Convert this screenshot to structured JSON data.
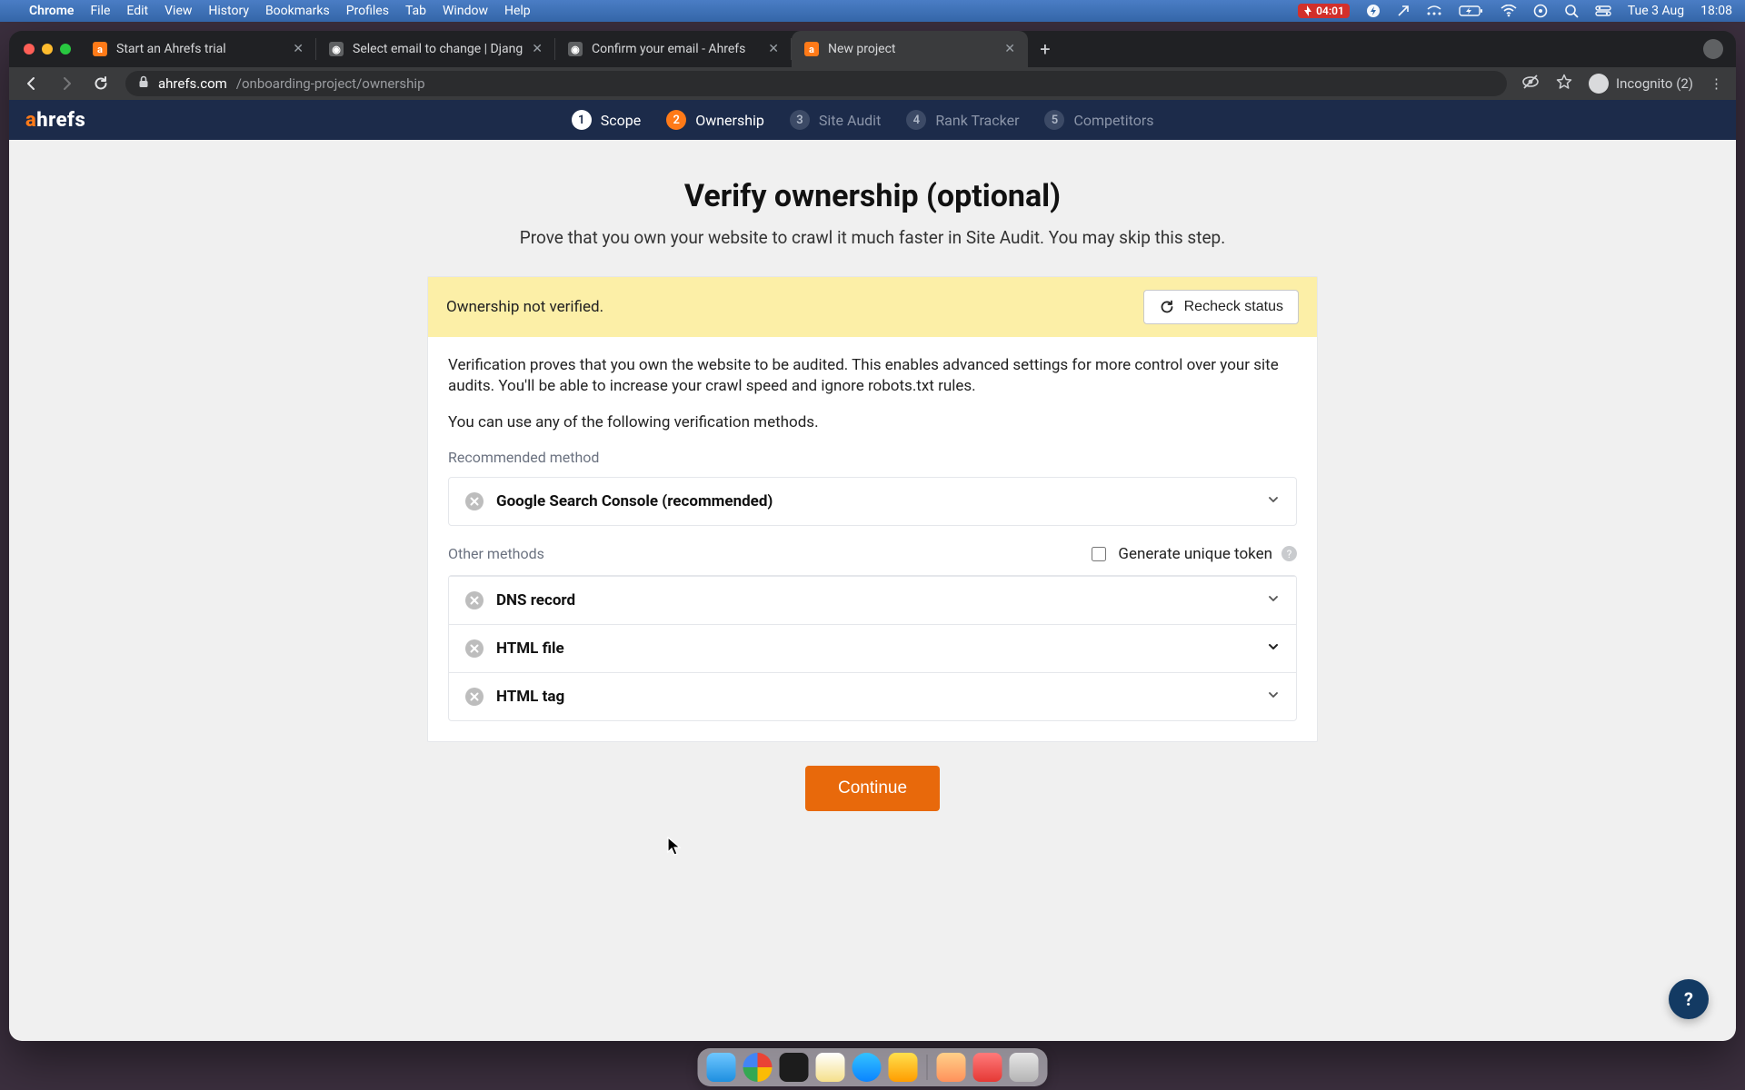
{
  "menubar": {
    "app": "Chrome",
    "items": [
      "File",
      "Edit",
      "View",
      "History",
      "Bookmarks",
      "Profiles",
      "Tab",
      "Window",
      "Help"
    ],
    "battery_timer": "04:01",
    "date": "Tue 3 Aug",
    "time": "18:08"
  },
  "browser": {
    "tabs": [
      {
        "title": "Start an Ahrefs trial",
        "active": false,
        "favicon": "ahrefs"
      },
      {
        "title": "Select email to change | Djang",
        "active": false,
        "favicon": "globe"
      },
      {
        "title": "Confirm your email - Ahrefs",
        "active": false,
        "favicon": "globe"
      },
      {
        "title": "New project",
        "active": true,
        "favicon": "ahrefs"
      }
    ],
    "url_domain": "ahrefs.com",
    "url_path": "/onboarding-project/ownership",
    "incognito_label": "Incognito (2)"
  },
  "appheader": {
    "logo_a": "a",
    "logo_rest": "hrefs",
    "steps": [
      {
        "num": "1",
        "label": "Scope",
        "state": "done"
      },
      {
        "num": "2",
        "label": "Ownership",
        "state": "active"
      },
      {
        "num": "3",
        "label": "Site Audit",
        "state": "pending"
      },
      {
        "num": "4",
        "label": "Rank Tracker",
        "state": "pending"
      },
      {
        "num": "5",
        "label": "Competitors",
        "state": "pending"
      }
    ]
  },
  "page": {
    "title": "Verify ownership (optional)",
    "subtitle": "Prove that you own your website to crawl it much faster in Site Audit. You may skip this step.",
    "status_text": "Ownership not verified.",
    "recheck_label": "Recheck status",
    "desc1": "Verification proves that you own the website to be audited. This enables advanced settings for more control over your site audits. You'll be able to increase your crawl speed and ignore robots.txt rules.",
    "desc2": "You can use any of the following verification methods.",
    "recommended_label": "Recommended method",
    "other_label": "Other methods",
    "generate_token_label": "Generate unique token",
    "methods_recommended": [
      {
        "name": "Google Search Console (recommended)"
      }
    ],
    "methods_other": [
      {
        "name": "DNS record"
      },
      {
        "name": "HTML file"
      },
      {
        "name": "HTML tag"
      }
    ],
    "continue_label": "Continue",
    "help_label": "?"
  },
  "dock": {
    "apps": [
      "finder",
      "chrome",
      "terminal",
      "notes",
      "safari",
      "vscode",
      "activity",
      "folder",
      "dashcam",
      "trash"
    ]
  }
}
